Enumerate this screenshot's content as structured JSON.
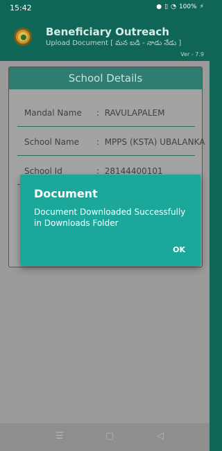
{
  "status_bar": {
    "time": "15:42",
    "icons": [
      "location-icon",
      "vibrate-icon",
      "wifi-icon"
    ],
    "battery": "100%"
  },
  "header": {
    "title": "Beneficiary Outreach",
    "subtitle": "Upload Document [ మన బడి - నాడు నేడు ]",
    "version": "Ver - 7.9"
  },
  "card": {
    "title": "School Details",
    "rows": [
      {
        "label": "Mandal Name",
        "separator": ":",
        "value": "RAVULAPALEM"
      },
      {
        "label": "School Name",
        "separator": ":",
        "value": "MPPS (KSTA) UBALANKA"
      },
      {
        "label": "School Id",
        "separator": ":",
        "value": "28144400101"
      }
    ]
  },
  "dialog": {
    "title": "Document",
    "message": "Document Downloaded Successfully in Downloads Folder",
    "ok_label": "OK"
  },
  "nav": {
    "recent_glyph": "☰",
    "home_glyph": "▢",
    "back_glyph": "◁"
  },
  "colors": {
    "primary": "#0f6656",
    "dialog": "#1ba89b",
    "card_header": "#2f7d70"
  }
}
